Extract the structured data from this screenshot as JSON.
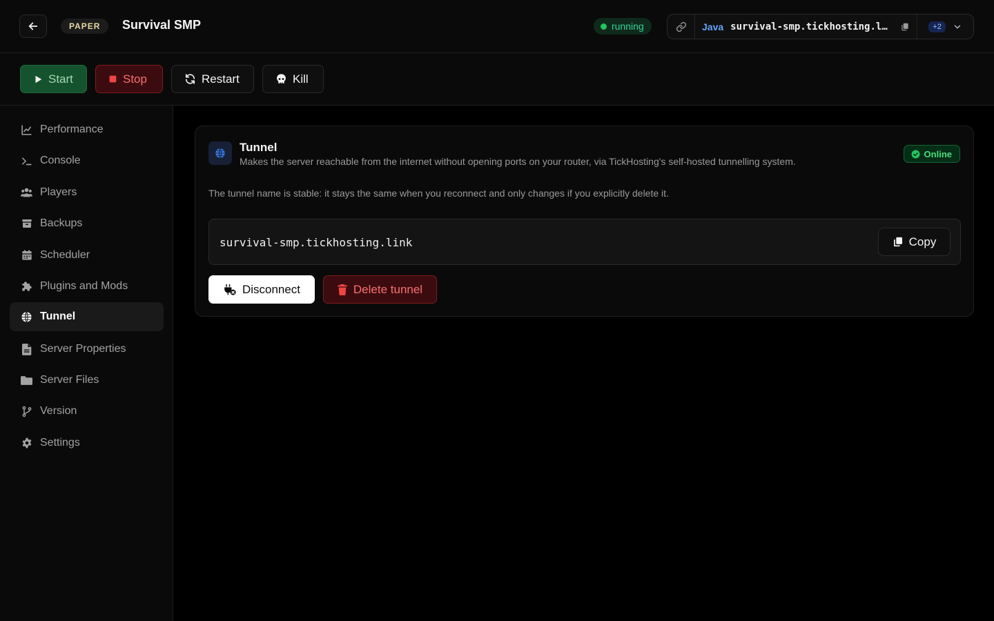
{
  "header": {
    "back_icon": "arrow-left-icon",
    "server_type": "PAPER",
    "server_name": "Survival SMP",
    "status": "running",
    "address": {
      "protocol": "Java",
      "host": "survival-smp.tickhosting.link",
      "extra_count": "+2"
    }
  },
  "toolbar": {
    "start_label": "Start",
    "stop_label": "Stop",
    "restart_label": "Restart",
    "kill_label": "Kill"
  },
  "sidebar": {
    "items": [
      {
        "label": "Performance",
        "icon": "chart-line-icon"
      },
      {
        "label": "Console",
        "icon": "terminal-icon"
      },
      {
        "label": "Players",
        "icon": "users-icon"
      },
      {
        "label": "Backups",
        "icon": "archive-icon"
      },
      {
        "label": "Scheduler",
        "icon": "calendar-icon"
      },
      {
        "label": "Plugins and Mods",
        "icon": "puzzle-icon"
      },
      {
        "label": "Tunnel",
        "icon": "globe-icon",
        "active": true
      },
      {
        "label": "Server Properties",
        "icon": "file-icon"
      },
      {
        "label": "Server Files",
        "icon": "folder-icon"
      },
      {
        "label": "Version",
        "icon": "git-branch-icon"
      },
      {
        "label": "Settings",
        "icon": "gear-icon"
      }
    ]
  },
  "tunnel": {
    "title": "Tunnel",
    "description": "Makes the server reachable from the internet without opening ports on your router, via TickHosting's self-hosted tunnelling system.",
    "status": "Online",
    "note": "The tunnel name is stable: it stays the same when you reconnect and only changes if you explicitly delete it.",
    "address": "survival-smp.tickhosting.link",
    "copy_label": "Copy",
    "disconnect_label": "Disconnect",
    "delete_label": "Delete tunnel"
  },
  "colors": {
    "background": "#000000",
    "panel": "#0a0a0a",
    "success": "#22c55e",
    "danger": "#f87171",
    "accent_blue": "#60a5fa"
  }
}
